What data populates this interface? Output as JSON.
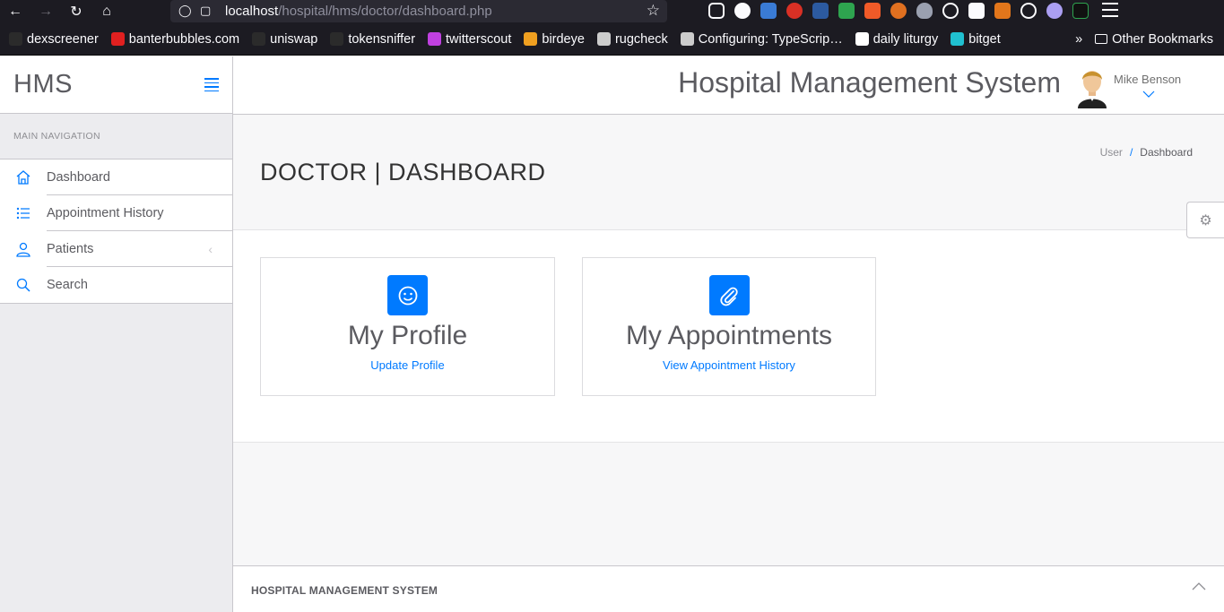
{
  "browser": {
    "url_host": "localhost",
    "url_path": "/hospital/hms/doctor/dashboard.php",
    "bookmarks": [
      {
        "label": "dexscreener",
        "color": "#2b2b2b"
      },
      {
        "label": "banterbubbles.com",
        "color": "#e02020"
      },
      {
        "label": "uniswap",
        "color": "#2b2b2b"
      },
      {
        "label": "tokensniffer",
        "color": "#2b2b2b"
      },
      {
        "label": "twitterscout",
        "color": "#c040e0"
      },
      {
        "label": "birdeye",
        "color": "#f0a020"
      },
      {
        "label": "rugcheck",
        "color": "#cccccc"
      },
      {
        "label": "Configuring: TypeScrip…",
        "color": "#cccccc"
      },
      {
        "label": "daily liturgy",
        "color": "#ffffff"
      },
      {
        "label": "bitget",
        "color": "#20c0d0"
      }
    ],
    "other_bookmarks": "Other Bookmarks"
  },
  "sidebar": {
    "brand": "HMS",
    "nav_heading": "MAIN NAVIGATION",
    "items": [
      {
        "label": "Dashboard",
        "icon": "home-icon"
      },
      {
        "label": "Appointment History",
        "icon": "list-icon"
      },
      {
        "label": "Patients",
        "icon": "user-icon"
      },
      {
        "label": "Search",
        "icon": "search-icon"
      }
    ]
  },
  "topbar": {
    "title": "Hospital Management System",
    "user_name": "Mike Benson"
  },
  "header": {
    "page_title": "DOCTOR | DASHBOARD",
    "breadcrumb": [
      "User",
      "Dashboard"
    ]
  },
  "cards": [
    {
      "title": "My Profile",
      "link": "Update Profile",
      "icon": "smile-icon"
    },
    {
      "title": "My Appointments",
      "link": "View Appointment History",
      "icon": "paperclip-icon"
    }
  ],
  "footer": {
    "text": "HOSPITAL MANAGEMENT SYSTEM"
  },
  "colors": {
    "accent": "#007aff",
    "browser_bg": "#1c1b22"
  }
}
